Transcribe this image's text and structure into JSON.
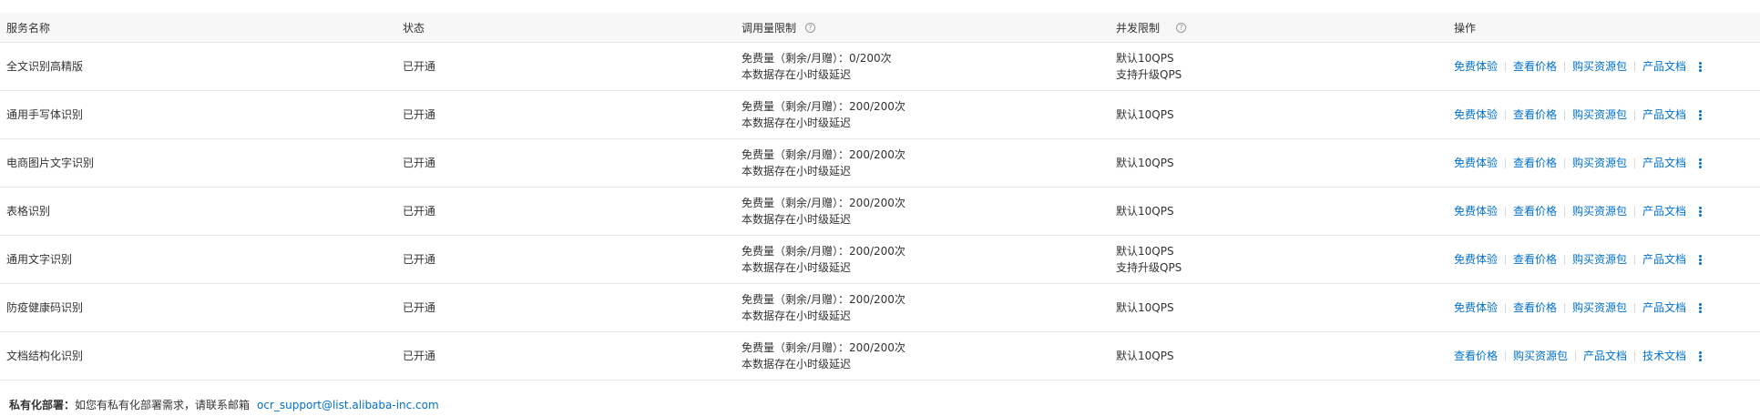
{
  "table": {
    "headers": {
      "name": "服务名称",
      "status": "状态",
      "quota": "调用量限制",
      "concurrency": "并发限制",
      "actions": "操作"
    },
    "help_icon_glyph": "?",
    "rows": [
      {
        "name": "全文识别高精版",
        "status": "已开通",
        "quota_line1": "免费量（剩余/月赠）：0/200次",
        "quota_line2": "本数据存在小时级延迟",
        "concurrency_line1": "默认10QPS",
        "concurrency_line2": "支持升级QPS",
        "actions": [
          "免费体验",
          "查看价格",
          "购买资源包",
          "产品文档"
        ]
      },
      {
        "name": "通用手写体识别",
        "status": "已开通",
        "quota_line1": "免费量（剩余/月赠）：200/200次",
        "quota_line2": "本数据存在小时级延迟",
        "concurrency_line1": "默认10QPS",
        "concurrency_line2": "",
        "actions": [
          "免费体验",
          "查看价格",
          "购买资源包",
          "产品文档"
        ]
      },
      {
        "name": "电商图片文字识别",
        "status": "已开通",
        "quota_line1": "免费量（剩余/月赠）：200/200次",
        "quota_line2": "本数据存在小时级延迟",
        "concurrency_line1": "默认10QPS",
        "concurrency_line2": "",
        "actions": [
          "免费体验",
          "查看价格",
          "购买资源包",
          "产品文档"
        ]
      },
      {
        "name": "表格识别",
        "status": "已开通",
        "quota_line1": "免费量（剩余/月赠）：200/200次",
        "quota_line2": "本数据存在小时级延迟",
        "concurrency_line1": "默认10QPS",
        "concurrency_line2": "",
        "actions": [
          "免费体验",
          "查看价格",
          "购买资源包",
          "产品文档"
        ]
      },
      {
        "name": "通用文字识别",
        "status": "已开通",
        "quota_line1": "免费量（剩余/月赠）：200/200次",
        "quota_line2": "本数据存在小时级延迟",
        "concurrency_line1": "默认10QPS",
        "concurrency_line2": "支持升级QPS",
        "actions": [
          "免费体验",
          "查看价格",
          "购买资源包",
          "产品文档"
        ]
      },
      {
        "name": "防疫健康码识别",
        "status": "已开通",
        "quota_line1": "免费量（剩余/月赠）：200/200次",
        "quota_line2": "本数据存在小时级延迟",
        "concurrency_line1": "默认10QPS",
        "concurrency_line2": "",
        "actions": [
          "免费体验",
          "查看价格",
          "购买资源包",
          "产品文档"
        ]
      },
      {
        "name": "文档结构化识别",
        "status": "已开通",
        "quota_line1": "免费量（剩余/月赠）：200/200次",
        "quota_line2": "本数据存在小时级延迟",
        "concurrency_line1": "默认10QPS",
        "concurrency_line2": "",
        "actions": [
          "查看价格",
          "购买资源包",
          "产品文档",
          "技术文档"
        ]
      }
    ]
  },
  "footer": {
    "label": "私有化部署：",
    "text": "如您有私有化部署需求，请联系邮箱",
    "email": "ocr_support@list.alibaba-inc.com"
  },
  "colors": {
    "link": "#0070cc",
    "header_bg": "#f7f7f7",
    "border": "#e8e8e8",
    "text": "#333333"
  }
}
